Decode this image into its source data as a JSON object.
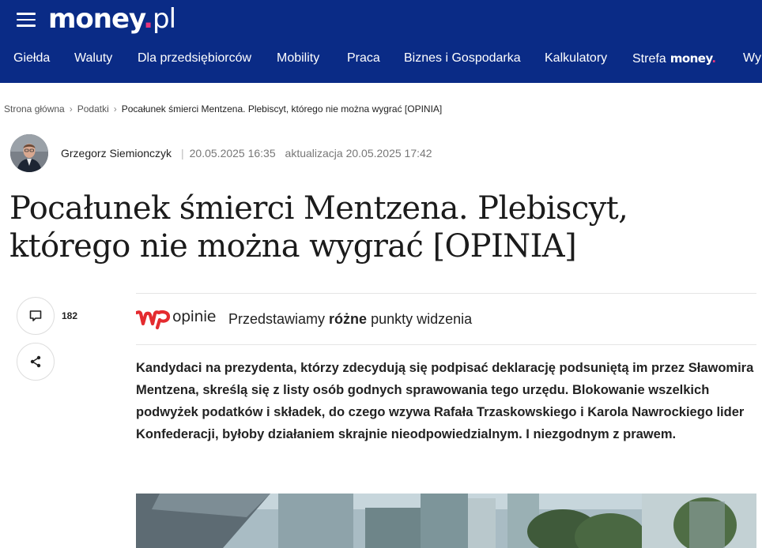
{
  "header": {
    "logo_main": "money",
    "logo_dot": ".",
    "logo_tld": "pl",
    "menu_icon": "hamburger-menu-icon",
    "nav": [
      {
        "label": "Giełda"
      },
      {
        "label": "Waluty"
      },
      {
        "label": "Dla przedsiębiorców"
      },
      {
        "label": "Mobility"
      },
      {
        "label": "Praca"
      },
      {
        "label": "Biznes i Gospodarka"
      },
      {
        "label": "Kalkulatory"
      },
      {
        "label": "Strefa",
        "logo_main": "money",
        "logo_dot": "."
      },
      {
        "label": "Wy"
      }
    ],
    "colors": {
      "background": "#0a2b86",
      "accent": "#e7357b"
    }
  },
  "breadcrumb": {
    "items": [
      "Strona główna",
      "Podatki"
    ],
    "current": "Pocałunek śmierci Mentzena. Plebiscyt, którego nie można wygrać [OPINIA]"
  },
  "article": {
    "author": "Grzegorz Siemionczyk",
    "published": "20.05.2025 16:35",
    "updated": "aktualizacja 20.05.2025 17:42",
    "title": "Pocałunek śmierci Mentzena. Plebiscyt, którego nie można wygrać [OPINIA]",
    "comments_count": "182",
    "opinion": {
      "logo_text": "opinie",
      "text_before": "Przedstawiamy ",
      "text_bold": "różne",
      "text_after": " punkty widzenia"
    },
    "lead": "Kandydaci na prezydenta, którzy zdecydują się podpisać deklarację podsuniętą im przez Sławomira Mentzena, skreślą się z listy osób godnych sprawowania tego urzędu. Blokowanie wszelkich podwyżek podatków i składek, do czego wzywa Rafała Trzaskowskiego i Karola Nawrockiego lider Konfederacji, byłoby działaniem skrajnie nieodpowiedzialnym. I niezgodnym z prawem."
  }
}
